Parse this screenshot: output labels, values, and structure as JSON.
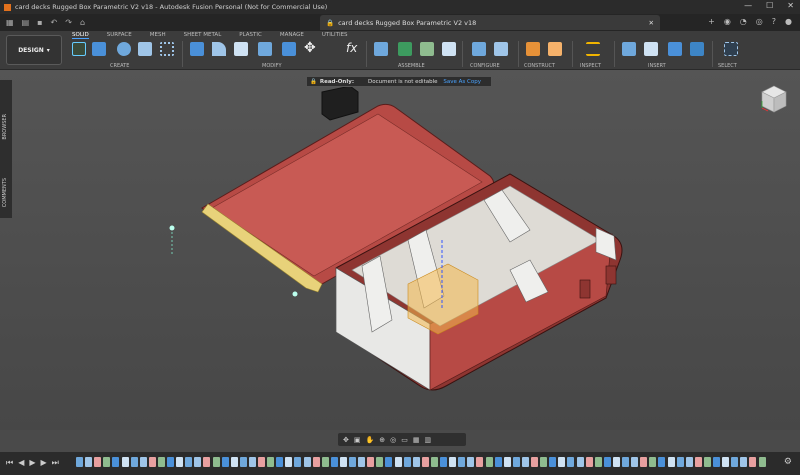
{
  "window": {
    "title": "card decks Rugged Box Parametric V2 v18 - Autodesk Fusion Personal (Not for Commercial Use)",
    "minimize": "—",
    "maximize": "☐",
    "close": "✕"
  },
  "document_tab": {
    "title": "card decks Rugged Box Parametric V2 v18",
    "close": "✕"
  },
  "ribbon": {
    "workspace": "DESIGN",
    "tabs": [
      "SOLID",
      "SURFACE",
      "MESH",
      "SHEET METAL",
      "PLASTIC",
      "MANAGE",
      "UTILITIES"
    ],
    "groups": [
      "CREATE",
      "MODIFY",
      "ASSEMBLE",
      "CONFIGURE",
      "CONSTRUCT",
      "INSPECT",
      "INSERT",
      "SELECT"
    ]
  },
  "banner": {
    "label": "Read-Only:",
    "message": "Document is not editable",
    "action": "Save As Copy"
  },
  "side_panel": {
    "browser": "BROWSER",
    "comments": "COMMENTS"
  },
  "colors": {
    "accent": "#4aa3ff",
    "box_red": "#b74a45",
    "box_red_dark": "#8e3531",
    "insert_white": "#e8e8e6",
    "origin_orange": "#f4b84c"
  }
}
